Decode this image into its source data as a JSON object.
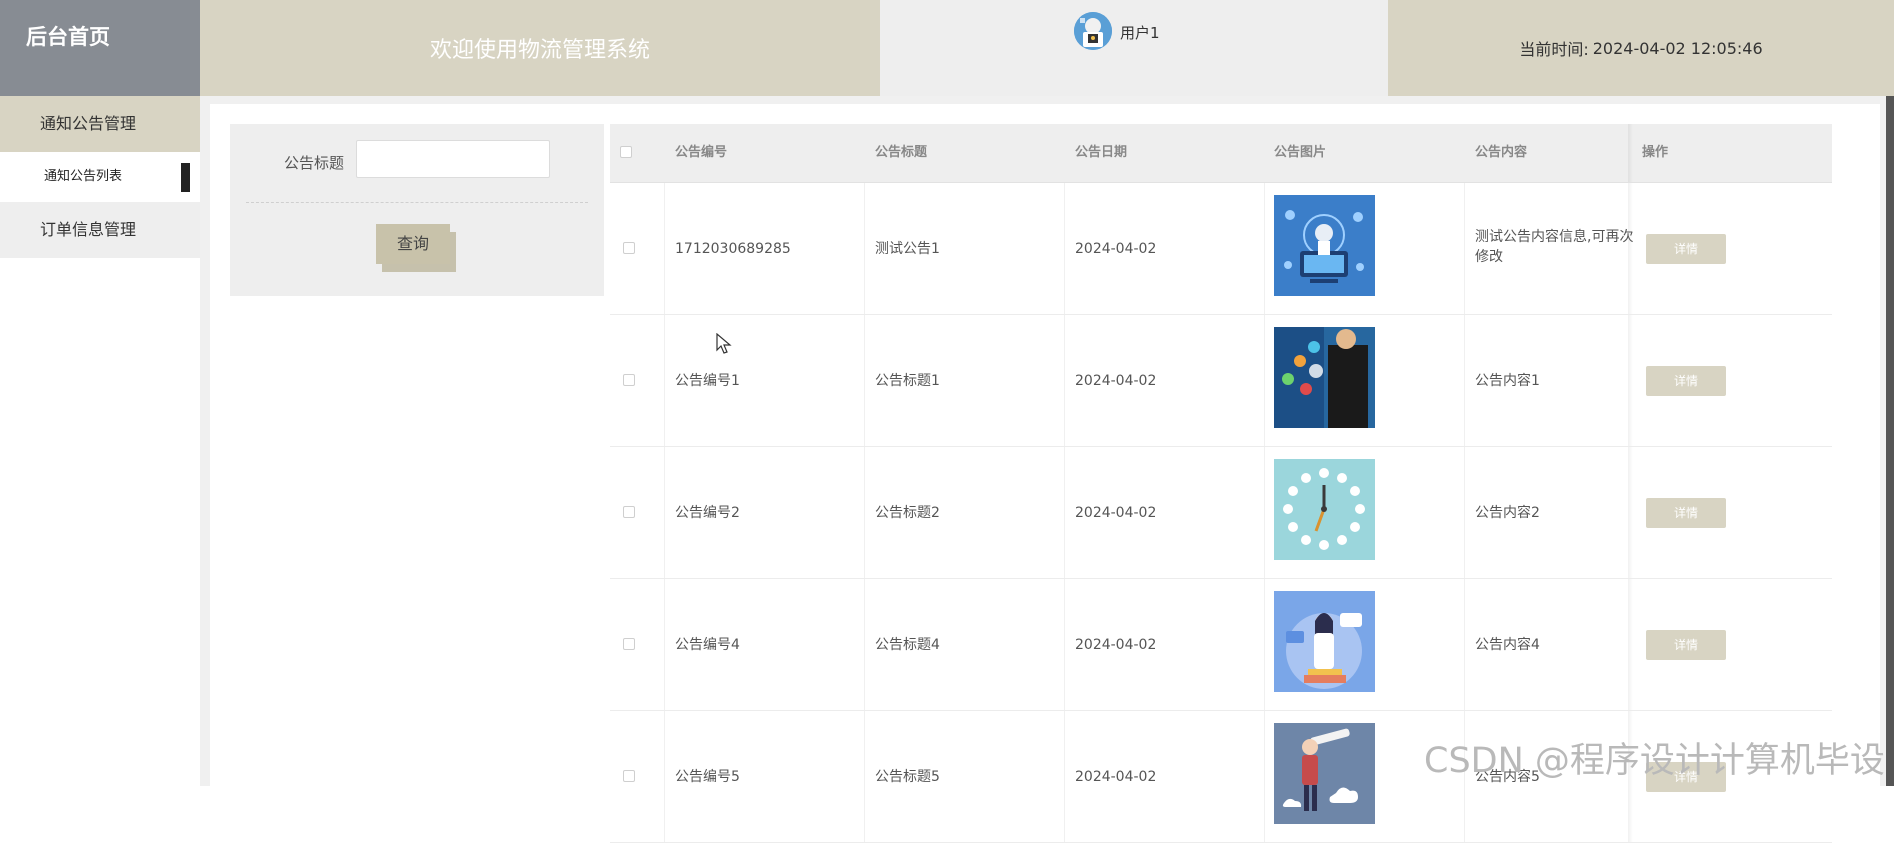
{
  "header": {
    "brand": "后台首页",
    "welcome": "欢迎使用物流管理系统",
    "username": "用户1",
    "time_label": "当前时间:",
    "time_value": "2024-04-02 12:05:46"
  },
  "sidebar": {
    "groups": [
      {
        "label": "通知公告管理",
        "items": [
          {
            "label": "通知公告列表"
          }
        ]
      },
      {
        "label": "订单信息管理",
        "items": []
      }
    ]
  },
  "search": {
    "field_label": "公告标题",
    "field_value": "",
    "button": "查询"
  },
  "table": {
    "columns": [
      "公告编号",
      "公告标题",
      "公告日期",
      "公告图片",
      "公告内容",
      "操作"
    ],
    "rows": [
      {
        "no": "1712030689285",
        "title": "测试公告1",
        "date": "2024-04-02",
        "image": "tech-robot-icon",
        "content": "测试公告内容信息,可再次修改",
        "action": "详情"
      },
      {
        "no": "公告编号1",
        "title": "公告标题1",
        "date": "2024-04-02",
        "image": "business-network-icon",
        "content": "公告内容1",
        "action": "详情"
      },
      {
        "no": "公告编号2",
        "title": "公告标题2",
        "date": "2024-04-02",
        "image": "clock-icon",
        "content": "公告内容2",
        "action": "详情"
      },
      {
        "no": "公告编号4",
        "title": "公告标题4",
        "date": "2024-04-02",
        "image": "woman-illustration-icon",
        "content": "公告内容4",
        "action": "详情"
      },
      {
        "no": "公告编号5",
        "title": "公告标题5",
        "date": "2024-04-02",
        "image": "telescope-illustration-icon",
        "content": "公告内容5",
        "action": "详情"
      }
    ]
  },
  "watermark": "CSDN @程序设计计算机毕设",
  "colors": {
    "accent": "#d8d4c3",
    "brand_bg": "#878c93",
    "panel": "#eeeeee"
  }
}
